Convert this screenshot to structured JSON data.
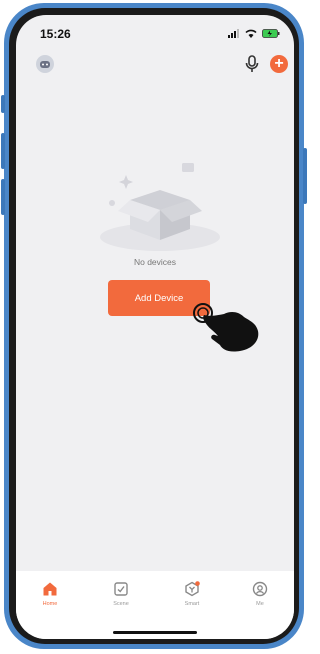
{
  "status_bar": {
    "time": "15:26"
  },
  "main": {
    "empty_text": "No devices",
    "add_button_label": "Add Device"
  },
  "tabbar": {
    "tabs": [
      {
        "label": "Home",
        "icon": "home-icon",
        "active": true
      },
      {
        "label": "Scene",
        "icon": "scene-icon",
        "active": false
      },
      {
        "label": "Smart",
        "icon": "smart-icon",
        "active": false
      },
      {
        "label": "Me",
        "icon": "profile-icon",
        "active": false
      }
    ]
  },
  "colors": {
    "accent": "#f26a3d",
    "frame": "#4a86c8",
    "background": "#f0f0f2"
  }
}
